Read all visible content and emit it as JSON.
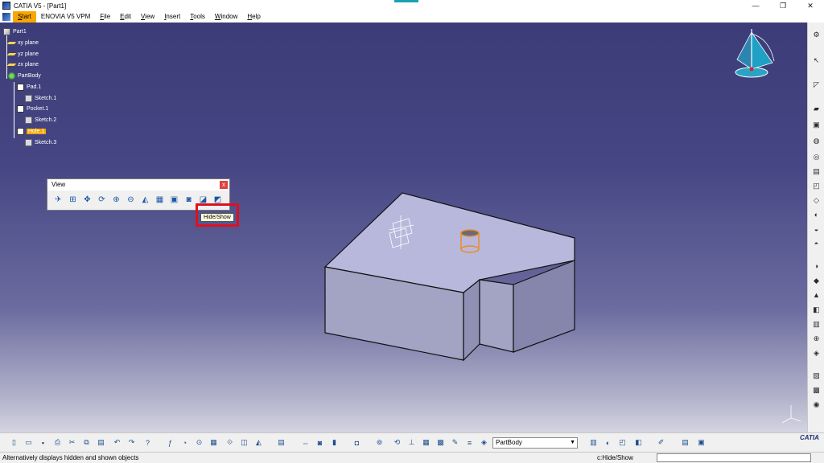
{
  "window": {
    "title": "CATIA V5 - [Part1]",
    "controls": {
      "minimize": "—",
      "restore": "❐",
      "close": "✕"
    }
  },
  "menu": {
    "items": [
      "Start",
      "ENOVIA V5 VPM",
      "File",
      "Edit",
      "View",
      "Insert",
      "Tools",
      "Window",
      "Help"
    ],
    "active": "Start"
  },
  "tree": {
    "root": "Part1",
    "planes": [
      "xy plane",
      "yz plane",
      "zx plane"
    ],
    "body": "PartBody",
    "features": [
      {
        "name": "Pad.1",
        "sketch": "Sketch.1"
      },
      {
        "name": "Pocket.1",
        "sketch": "Sketch.2"
      },
      {
        "name": "Hole.1",
        "sketch": "Sketch.3",
        "selected": true
      }
    ]
  },
  "view_toolbar": {
    "title": "View",
    "close": "x",
    "icons": [
      "fly-mode-icon",
      "fit-all-icon",
      "pan-icon",
      "rotate-icon",
      "zoom-in-icon",
      "zoom-out-icon",
      "normal-view-icon",
      "multi-view-icon",
      "iso-view-icon",
      "render-style-icon",
      "hide-show-icon",
      "swap-visible-space-icon"
    ],
    "tooltip": "Hide/Show",
    "highlight_color": "#e0101e"
  },
  "bottom_toolbar": {
    "current_body": "PartBody"
  },
  "status": {
    "message": "Alternatively displays hidden and shown objects",
    "command_label": "c:Hide/Show",
    "command_value": ""
  },
  "colors": {
    "accent": "#f7a700",
    "viewport_top": "#3c3c78",
    "part_face": "#b8b8dc"
  },
  "logo": "CATIA"
}
